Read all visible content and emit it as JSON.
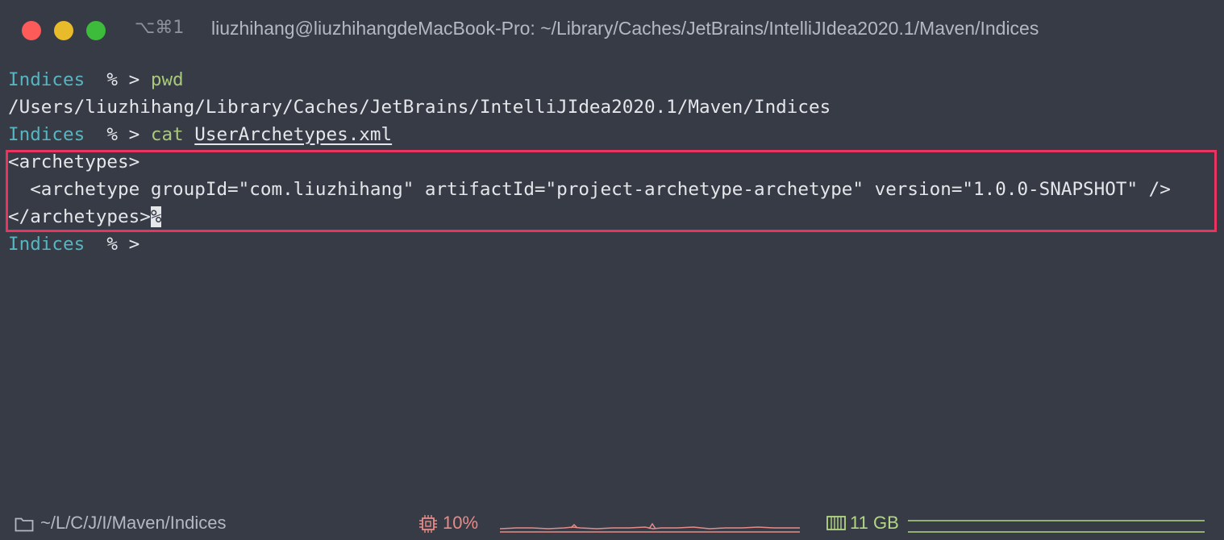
{
  "window": {
    "shortcut": "⌥⌘1",
    "title": "liuzhihang@liuzhihangdeMacBook-Pro: ~/Library/Caches/JetBrains/IntelliJIdea2020.1/Maven/Indices"
  },
  "terminal": {
    "lines": [
      {
        "dir": "Indices",
        "prompt": "  % > ",
        "cmd": "pwd",
        "arg": ""
      },
      {
        "output": "/Users/liuzhihang/Library/Caches/JetBrains/IntelliJIdea2020.1/Maven/Indices"
      },
      {
        "dir": "Indices",
        "prompt": "  % > ",
        "cmd": "cat",
        "arg": "UserArchetypes.xml"
      },
      {
        "output": "<archetypes>"
      },
      {
        "output": "  <archetype groupId=\"com.liuzhihang\" artifactId=\"project-archetype-archetype\" version=\"1.0.0-SNAPSHOT\" />"
      },
      {
        "output": "</archetypes>",
        "cursor": "%"
      },
      {
        "dir": "Indices",
        "prompt": "  % >",
        "cmd": "",
        "arg": ""
      }
    ]
  },
  "status": {
    "path": "~/L/C/J/I/Maven/Indices",
    "cpu": "10%",
    "memory": "11 GB"
  },
  "colors": {
    "background": "#373b46",
    "dir": "#55b6c2",
    "command": "#a9c87a",
    "highlight": "#e8345e",
    "cpu": "#e88b87",
    "memory": "#b3d783"
  },
  "icons": {
    "status_path": "folder-icon",
    "status_cpu": "cpu-chip-icon",
    "status_memory": "memory-icon"
  }
}
